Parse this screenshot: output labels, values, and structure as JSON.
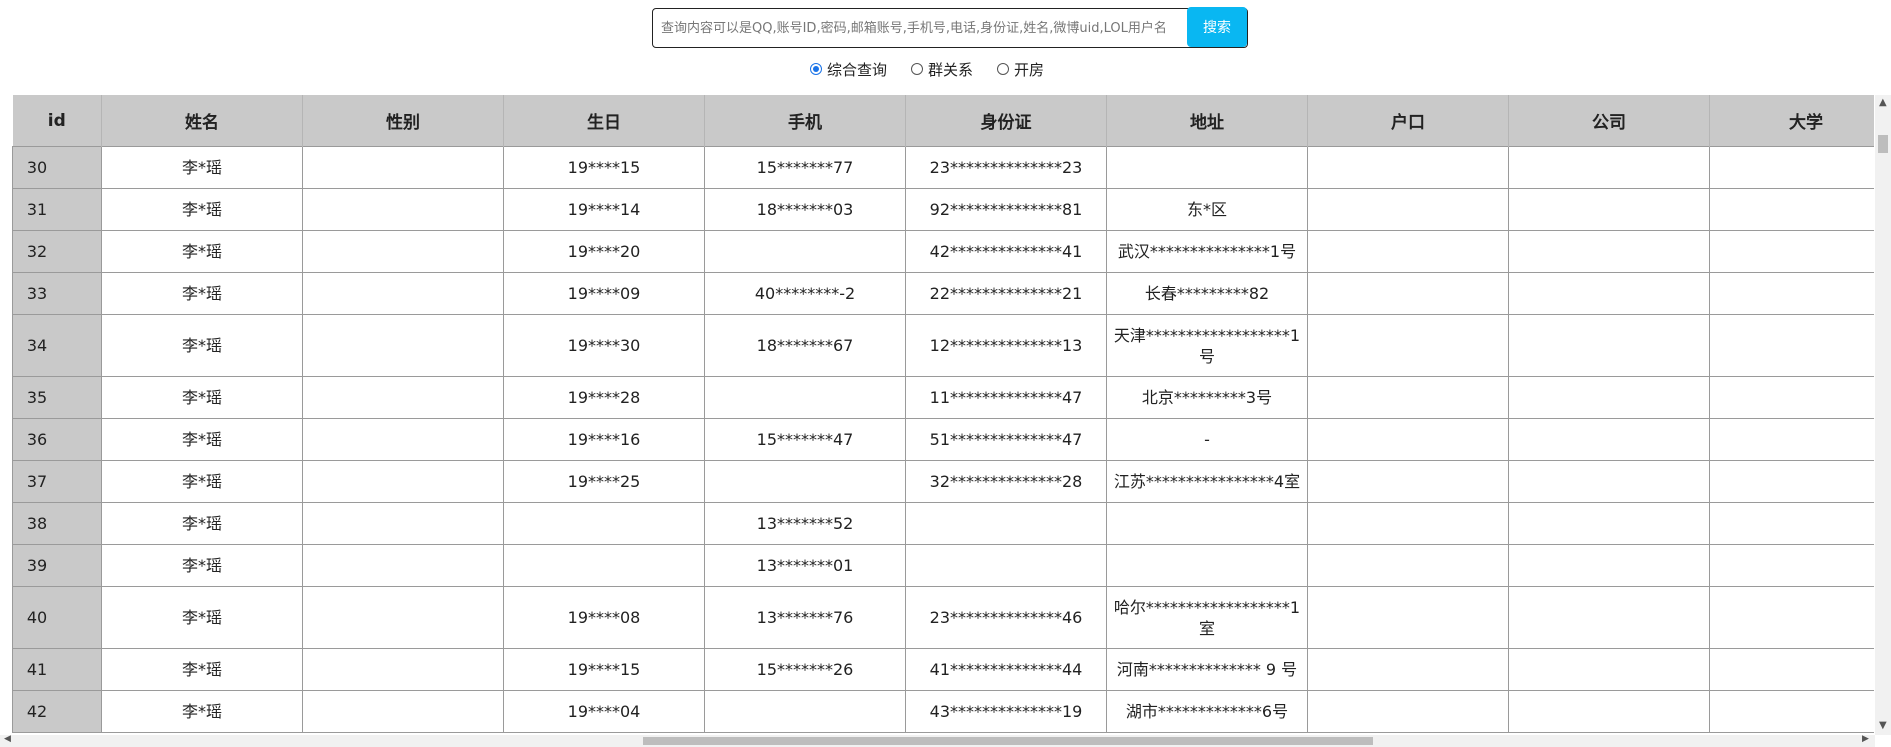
{
  "search": {
    "placeholder": "查询内容可以是QQ,账号ID,密码,邮箱账号,手机号,电话,身份证,姓名,微博uid,LOL用户名",
    "button_label": "搜索"
  },
  "query_modes": [
    {
      "label": "综合查询",
      "selected": true
    },
    {
      "label": "群关系",
      "selected": false
    },
    {
      "label": "开房",
      "selected": false
    }
  ],
  "table": {
    "columns": [
      "id",
      "姓名",
      "性别",
      "生日",
      "手机",
      "身份证",
      "地址",
      "户口",
      "公司",
      "大学"
    ],
    "rows": [
      {
        "id": "30",
        "name": "李*瑶",
        "gender": "",
        "birthday": "19****15",
        "phone": "15*******77",
        "id_card": "23**************23",
        "address": "",
        "hukou": "",
        "company": "",
        "university": ""
      },
      {
        "id": "31",
        "name": "李*瑶",
        "gender": "",
        "birthday": "19****14",
        "phone": "18*******03",
        "id_card": "92**************81",
        "address": "东*区",
        "hukou": "",
        "company": "",
        "university": ""
      },
      {
        "id": "32",
        "name": "李*瑶",
        "gender": "",
        "birthday": "19****20",
        "phone": "",
        "id_card": "42**************41",
        "address": "武汉***************1号",
        "hukou": "",
        "company": "",
        "university": ""
      },
      {
        "id": "33",
        "name": "李*瑶",
        "gender": "",
        "birthday": "19****09",
        "phone": "40********-2",
        "id_card": "22**************21",
        "address": "长春*********82",
        "hukou": "",
        "company": "",
        "university": ""
      },
      {
        "id": "34",
        "name": "李*瑶",
        "gender": "",
        "birthday": "19****30",
        "phone": "18*******67",
        "id_card": "12**************13",
        "address": "天津******************1号",
        "hukou": "",
        "company": "",
        "university": ""
      },
      {
        "id": "35",
        "name": "李*瑶",
        "gender": "",
        "birthday": "19****28",
        "phone": "",
        "id_card": "11**************47",
        "address": "北京*********3号",
        "hukou": "",
        "company": "",
        "university": ""
      },
      {
        "id": "36",
        "name": "李*瑶",
        "gender": "",
        "birthday": "19****16",
        "phone": "15*******47",
        "id_card": "51**************47",
        "address": "-",
        "hukou": "",
        "company": "",
        "university": ""
      },
      {
        "id": "37",
        "name": "李*瑶",
        "gender": "",
        "birthday": "19****25",
        "phone": "",
        "id_card": "32**************28",
        "address": "江苏****************4室",
        "hukou": "",
        "company": "",
        "university": ""
      },
      {
        "id": "38",
        "name": "李*瑶",
        "gender": "",
        "birthday": "",
        "phone": "13*******52",
        "id_card": "",
        "address": "",
        "hukou": "",
        "company": "",
        "university": ""
      },
      {
        "id": "39",
        "name": "李*瑶",
        "gender": "",
        "birthday": "",
        "phone": "13*******01",
        "id_card": "",
        "address": "",
        "hukou": "",
        "company": "",
        "university": ""
      },
      {
        "id": "40",
        "name": "李*瑶",
        "gender": "",
        "birthday": "19****08",
        "phone": "13*******76",
        "id_card": "23**************46",
        "address": "哈尔******************1室",
        "hukou": "",
        "company": "",
        "university": ""
      },
      {
        "id": "41",
        "name": "李*瑶",
        "gender": "",
        "birthday": "19****15",
        "phone": "15*******26",
        "id_card": "41**************44",
        "address": "河南************** 9 号",
        "hukou": "",
        "company": "",
        "university": ""
      },
      {
        "id": "42",
        "name": "李*瑶",
        "gender": "",
        "birthday": "19****04",
        "phone": "",
        "id_card": "43**************19",
        "address": "湖市*************6号",
        "hukou": "",
        "company": "",
        "university": ""
      }
    ]
  },
  "colors": {
    "accent": "#09b7f2",
    "header_bg": "#c9c9c9"
  }
}
